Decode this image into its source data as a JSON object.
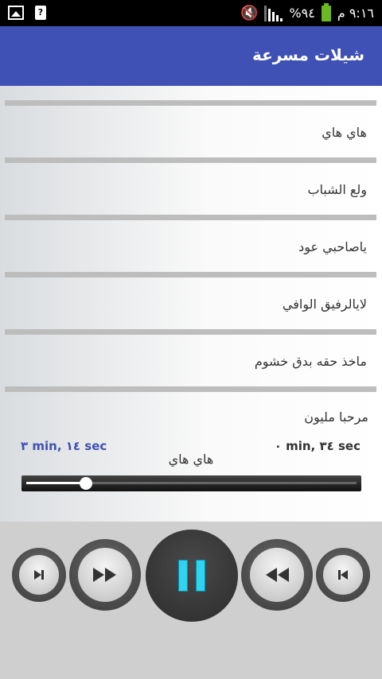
{
  "status": {
    "time": "٩:١٦ م",
    "battery": "٩٤%"
  },
  "appbar": {
    "title": "شيلات مسرعة"
  },
  "playlist": [
    {
      "title": "هاي هاي"
    },
    {
      "title": "ولع الشباب"
    },
    {
      "title": "ياصاحبي عود"
    },
    {
      "title": "لايالرفيق الوافي"
    },
    {
      "title": "ماخذ حقه بدق خشوم"
    }
  ],
  "playlist_last": {
    "title": "مرحبا مليون"
  },
  "player": {
    "elapsed": "٣ min, ١٤ sec",
    "remaining": "٠ min, ٣٤ sec",
    "now_playing": "هاي هاي",
    "progress": 0.18
  },
  "colors": {
    "appbar": "#3f51b5",
    "accent": "#2fd4f0",
    "time_left": "#3f51b5"
  },
  "icons": [
    "image-icon",
    "notification-icon",
    "mute-icon",
    "signal-icon",
    "battery-icon",
    "skip-next-icon",
    "fast-forward-icon",
    "pause-icon",
    "rewind-icon",
    "skip-previous-icon"
  ]
}
